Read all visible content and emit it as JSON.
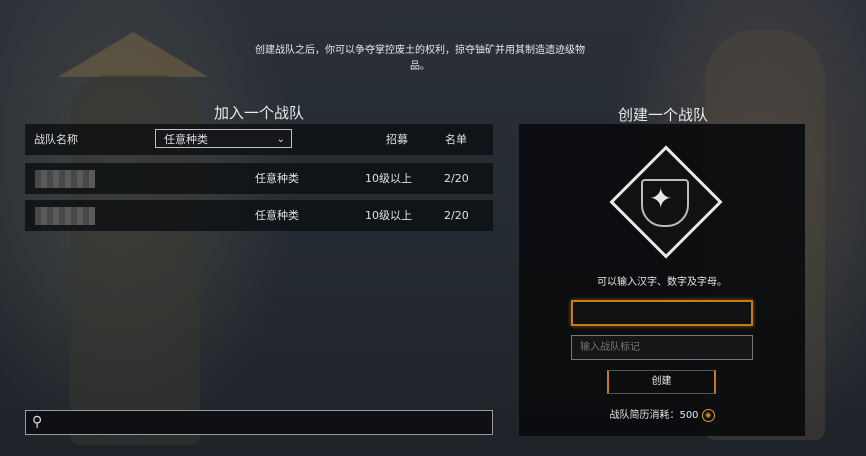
{
  "intro_text": "创建战队之后，你可以争夺掌控废土的权利，掠夺铀矿并用其制造遗迹级物品。",
  "join": {
    "title": "加入一个战队",
    "headers": {
      "name": "战队名称",
      "type_filter": "任意种类",
      "recruit": "招募",
      "roster": "名单"
    },
    "rows": [
      {
        "type": "任意种类",
        "level": "10级以上",
        "count": "2/20"
      },
      {
        "type": "任意种类",
        "level": "10级以上",
        "count": "2/20"
      }
    ],
    "search_icon": "search-icon"
  },
  "create": {
    "title": "创建一个战队",
    "hint": "可以输入汉字、数字及字母。",
    "tag_placeholder": "输入战队标记",
    "button_label": "创建",
    "cost_label": "战队简历消耗：500",
    "accent_color": "#c77a18"
  }
}
